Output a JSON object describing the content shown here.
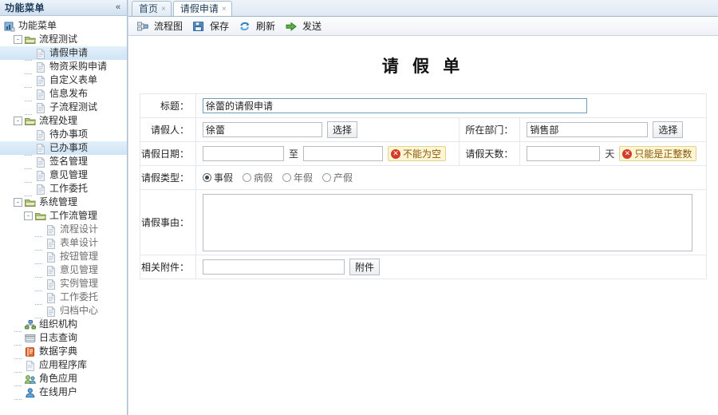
{
  "sidebar": {
    "header_title": "功能菜单",
    "collapse_icon": "chevron-double-left",
    "root": {
      "label": "功能菜单",
      "icon": "app-menu-icon"
    },
    "nodes": [
      {
        "label": "流程测试",
        "depth": 1,
        "icon": "folder-icon",
        "expander": "-",
        "selected": false
      },
      {
        "label": "请假申请",
        "depth": 2,
        "icon": "file-icon",
        "expander": "",
        "selected": true
      },
      {
        "label": "物资采购申请",
        "depth": 2,
        "icon": "file-icon",
        "expander": "",
        "selected": false
      },
      {
        "label": "自定义表单",
        "depth": 2,
        "icon": "file-icon",
        "expander": "",
        "selected": false
      },
      {
        "label": "信息发布",
        "depth": 2,
        "icon": "file-icon",
        "expander": "",
        "selected": false
      },
      {
        "label": "子流程测试",
        "depth": 2,
        "icon": "file-icon",
        "expander": "",
        "selected": false
      },
      {
        "label": "流程处理",
        "depth": 1,
        "icon": "folder-icon",
        "expander": "-",
        "selected": false
      },
      {
        "label": "待办事项",
        "depth": 2,
        "icon": "file-icon",
        "expander": "",
        "selected": false
      },
      {
        "label": "已办事项",
        "depth": 2,
        "icon": "file-icon",
        "expander": "",
        "selected": true
      },
      {
        "label": "签名管理",
        "depth": 2,
        "icon": "file-icon",
        "expander": "",
        "selected": false
      },
      {
        "label": "意见管理",
        "depth": 2,
        "icon": "file-icon",
        "expander": "",
        "selected": false
      },
      {
        "label": "工作委托",
        "depth": 2,
        "icon": "file-icon",
        "expander": "",
        "selected": false
      },
      {
        "label": "系统管理",
        "depth": 1,
        "icon": "folder-icon",
        "expander": "-",
        "selected": false
      },
      {
        "label": "工作流管理",
        "depth": 2,
        "icon": "folder-icon",
        "expander": "-",
        "selected": false
      },
      {
        "label": "流程设计",
        "depth": 3,
        "icon": "file-icon",
        "expander": "",
        "selected": false
      },
      {
        "label": "表单设计",
        "depth": 3,
        "icon": "file-icon",
        "expander": "",
        "selected": false
      },
      {
        "label": "按钮管理",
        "depth": 3,
        "icon": "file-icon",
        "expander": "",
        "selected": false
      },
      {
        "label": "意见管理",
        "depth": 3,
        "icon": "file-icon",
        "expander": "",
        "selected": false
      },
      {
        "label": "实例管理",
        "depth": 3,
        "icon": "file-icon",
        "expander": "",
        "selected": false
      },
      {
        "label": "工作委托",
        "depth": 3,
        "icon": "file-icon",
        "expander": "",
        "selected": false
      },
      {
        "label": "归档中心",
        "depth": 3,
        "icon": "file-icon",
        "expander": "",
        "selected": false
      },
      {
        "label": "组织机构",
        "depth": 1,
        "icon": "org-icon",
        "expander": "",
        "selected": false
      },
      {
        "label": "日志查询",
        "depth": 1,
        "icon": "log-icon",
        "expander": "",
        "selected": false
      },
      {
        "label": "数据字典",
        "depth": 1,
        "icon": "dict-icon",
        "expander": "",
        "selected": false
      },
      {
        "label": "应用程序库",
        "depth": 1,
        "icon": "applib-icon",
        "expander": "",
        "selected": false
      },
      {
        "label": "角色应用",
        "depth": 1,
        "icon": "role-icon",
        "expander": "",
        "selected": false
      },
      {
        "label": "在线用户",
        "depth": 1,
        "icon": "user-icon",
        "expander": "",
        "selected": false
      }
    ]
  },
  "tabs": [
    {
      "label": "首页",
      "active": false,
      "close": "×"
    },
    {
      "label": "请假申请",
      "active": true,
      "close": "×"
    }
  ],
  "toolbar": {
    "buttons": [
      {
        "label": "流程图",
        "icon": "flowchart-icon"
      },
      {
        "label": "保存",
        "icon": "save-icon"
      },
      {
        "label": "刷新",
        "icon": "refresh-icon"
      },
      {
        "label": "发送",
        "icon": "send-icon"
      }
    ]
  },
  "form": {
    "title": "请 假 单",
    "title_row": {
      "label": "标题：",
      "value": "徐蕾的请假申请"
    },
    "applicant_row": {
      "label": "请假人：",
      "value": "徐蕾",
      "button": "选择"
    },
    "department_row": {
      "label": "所在部门：",
      "value": "销售部",
      "button": "选择"
    },
    "date_row": {
      "label": "请假日期：",
      "from": "",
      "sep": "至",
      "to": "",
      "warning": "不能为空",
      "warning_icon": "error-circle-icon"
    },
    "days_row": {
      "label": "请假天数：",
      "value": "",
      "unit": "天",
      "warning": "只能是正整数",
      "warning_icon": "error-circle-icon"
    },
    "type_row": {
      "label": "请假类型：",
      "options": [
        {
          "label": "事假",
          "checked": true
        },
        {
          "label": "病假",
          "checked": false
        },
        {
          "label": "年假",
          "checked": false
        },
        {
          "label": "产假",
          "checked": false
        }
      ]
    },
    "reason_row": {
      "label": "请假事由：",
      "value": ""
    },
    "attach_row": {
      "label": "相关附件：",
      "value": "",
      "button": "附件"
    }
  },
  "colors": {
    "accent": "#2c4a66",
    "sidebar_header": "#dfeaf5",
    "selection": "#cfe4f5",
    "warning_bg": "#fdf5d3",
    "warning_text": "#8a5a12",
    "error_red": "#d23b27",
    "send_green": "#3f9c35",
    "focus_border": "#6d9eb8"
  }
}
